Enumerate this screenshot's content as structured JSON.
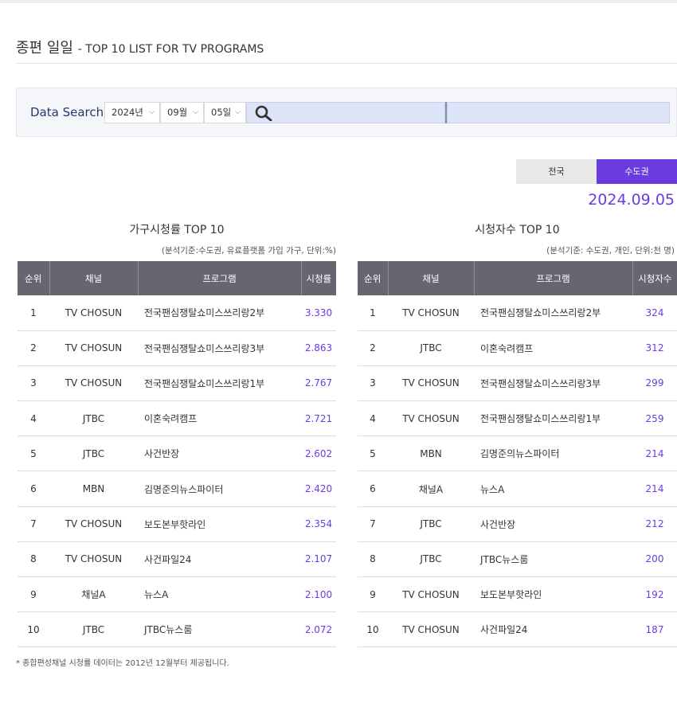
{
  "header": {
    "title_ko": "종편 일일",
    "title_en": "- TOP 10 LIST FOR TV PROGRAMS"
  },
  "search": {
    "label": "Data Search",
    "year": "2024년",
    "month": "09월",
    "day": "05일",
    "search_icon": "magnifier-icon"
  },
  "region_tabs": [
    {
      "label": "전국",
      "active": false
    },
    {
      "label": "수도권",
      "active": true
    }
  ],
  "date": "2024.09.05",
  "household": {
    "title": "가구시청률 TOP 10",
    "note": "(분석기준:수도권, 유료플랫폼 가입 가구, 단위:%)",
    "columns": [
      "순위",
      "채널",
      "프로그램",
      "시청률"
    ],
    "rows": [
      [
        "1",
        "TV CHOSUN",
        "전국팬심쟁탈쇼미스쓰리랑2부",
        "3.330"
      ],
      [
        "2",
        "TV CHOSUN",
        "전국팬심쟁탈쇼미스쓰리랑3부",
        "2.863"
      ],
      [
        "3",
        "TV CHOSUN",
        "전국팬심쟁탈쇼미스쓰리랑1부",
        "2.767"
      ],
      [
        "4",
        "JTBC",
        "이혼숙려캠프",
        "2.721"
      ],
      [
        "5",
        "JTBC",
        "사건반장",
        "2.602"
      ],
      [
        "6",
        "MBN",
        "김명준의뉴스파이터",
        "2.420"
      ],
      [
        "7",
        "TV CHOSUN",
        "보도본부핫라인",
        "2.354"
      ],
      [
        "8",
        "TV CHOSUN",
        "사건파일24",
        "2.107"
      ],
      [
        "9",
        "채널A",
        "뉴스A",
        "2.100"
      ],
      [
        "10",
        "JTBC",
        "JTBC뉴스룸",
        "2.072"
      ]
    ]
  },
  "viewers": {
    "title": "시청자수 TOP 10",
    "note": "(분석기준: 수도권, 개인, 단위:천 명)",
    "columns": [
      "순위",
      "채널",
      "프로그램",
      "시청자수"
    ],
    "rows": [
      [
        "1",
        "TV CHOSUN",
        "전국팬심쟁탈쇼미스쓰리랑2부",
        "324"
      ],
      [
        "2",
        "JTBC",
        "이혼숙려캠프",
        "312"
      ],
      [
        "3",
        "TV CHOSUN",
        "전국팬심쟁탈쇼미스쓰리랑3부",
        "299"
      ],
      [
        "4",
        "TV CHOSUN",
        "전국팬심쟁탈쇼미스쓰리랑1부",
        "259"
      ],
      [
        "5",
        "MBN",
        "김명준의뉴스파이터",
        "214"
      ],
      [
        "6",
        "채널A",
        "뉴스A",
        "214"
      ],
      [
        "7",
        "JTBC",
        "사건반장",
        "212"
      ],
      [
        "8",
        "JTBC",
        "JTBC뉴스룸",
        "200"
      ],
      [
        "9",
        "TV CHOSUN",
        "보도본부핫라인",
        "192"
      ],
      [
        "10",
        "TV CHOSUN",
        "사건파일24",
        "187"
      ]
    ]
  },
  "footnote": "* 종합편성채널 시청률 데이터는 2012년 12월부터 제공됩니다.",
  "colors": {
    "accent": "#6a3ce0",
    "header_bg": "#666670",
    "search_label": "#26366e"
  }
}
